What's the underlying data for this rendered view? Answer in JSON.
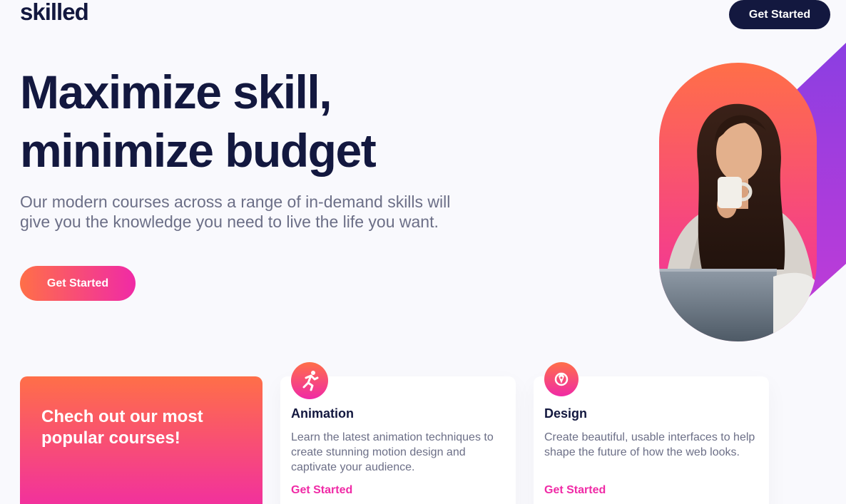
{
  "header": {
    "logo": "skilled",
    "cta_label": "Get Started"
  },
  "hero": {
    "title": "Maximize skill, minimize budget",
    "subtitle": "Our modern courses across a range of in-demand skills will give you the knowledge you need to live the life you want.",
    "cta_label": "Get Started"
  },
  "promo": {
    "text": "Chech out our most popular courses!"
  },
  "courses": [
    {
      "icon": "running-person-icon",
      "title": "Animation",
      "description": "Learn the latest animation techniques to create stunning motion design and captivate your audience.",
      "link_label": "Get Started"
    },
    {
      "icon": "design-tool-icon",
      "title": "Design",
      "description": "Create beautiful, usable interfaces to help shape the future of how the web looks.",
      "link_label": "Get Started"
    }
  ],
  "colors": {
    "navy": "#13183f",
    "gray": "#6c6f87",
    "gradient_start": "#ff6f48",
    "gradient_end": "#f02aa6",
    "purple": "#9a3ce0",
    "background": "#f9f9fd"
  }
}
